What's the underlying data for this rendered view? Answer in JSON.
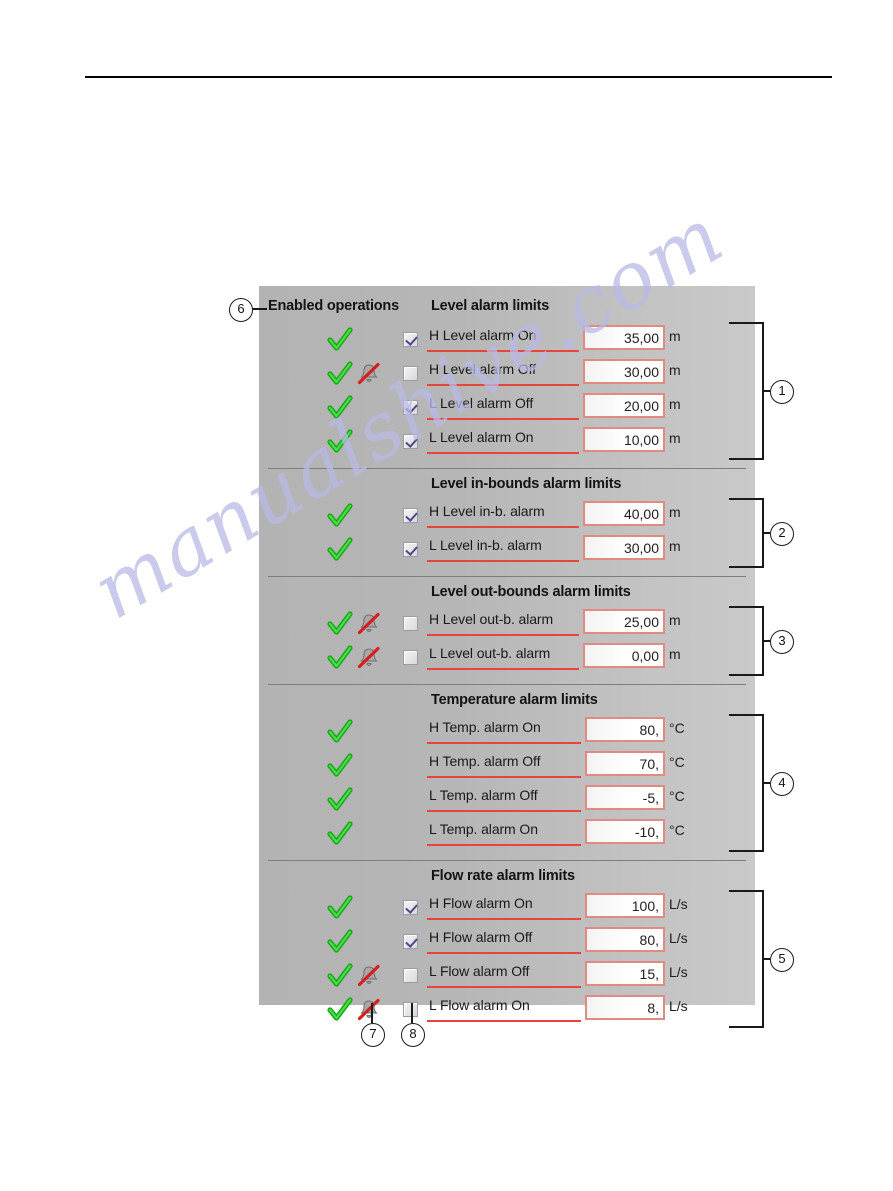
{
  "page": {
    "watermark_text": "manualshive.com",
    "accent_red": "#e8443c",
    "field_border": "#e08a84",
    "panel_gray": "#bcbcbc",
    "check_green": "#22bb22",
    "bell_red": "#d41f1f"
  },
  "panel": {
    "enabled_operations_header": "Enabled operations",
    "sections": [
      {
        "title": "Level alarm limits",
        "callout": "1",
        "rows": [
          {
            "ok": true,
            "bell": false,
            "checkbox": true,
            "label": "H Level alarm On",
            "value": "35,00",
            "unit": "m"
          },
          {
            "ok": true,
            "bell": true,
            "checkbox": false,
            "label": "H Level alarm Off",
            "value": "30,00",
            "unit": "m"
          },
          {
            "ok": true,
            "bell": false,
            "checkbox": true,
            "label": "L Level alarm Off",
            "value": "20,00",
            "unit": "m"
          },
          {
            "ok": true,
            "bell": false,
            "checkbox": true,
            "label": "L Level alarm On",
            "value": "10,00",
            "unit": "m"
          }
        ]
      },
      {
        "title": "Level in-bounds alarm limits",
        "callout": "2",
        "rows": [
          {
            "ok": true,
            "bell": false,
            "checkbox": true,
            "label": "H Level in-b. alarm",
            "value": "40,00",
            "unit": "m"
          },
          {
            "ok": true,
            "bell": false,
            "checkbox": true,
            "label": "L Level in-b. alarm",
            "value": "30,00",
            "unit": "m"
          }
        ]
      },
      {
        "title": "Level out-bounds alarm limits",
        "callout": "3",
        "rows": [
          {
            "ok": true,
            "bell": true,
            "checkbox": false,
            "label": "H Level out-b. alarm",
            "value": "25,00",
            "unit": "m"
          },
          {
            "ok": true,
            "bell": true,
            "checkbox": false,
            "label": "L Level out-b. alarm",
            "value": "0,00",
            "unit": "m"
          }
        ]
      },
      {
        "title": "Temperature alarm limits",
        "callout": "4",
        "rows": [
          {
            "ok": true,
            "bell": false,
            "checkbox": null,
            "label": "H Temp. alarm On",
            "value": "80,",
            "unit": "°C"
          },
          {
            "ok": true,
            "bell": false,
            "checkbox": null,
            "label": "H Temp. alarm Off",
            "value": "70,",
            "unit": "°C"
          },
          {
            "ok": true,
            "bell": false,
            "checkbox": null,
            "label": "L Temp. alarm Off",
            "value": "-5,",
            "unit": "°C"
          },
          {
            "ok": true,
            "bell": false,
            "checkbox": null,
            "label": "L Temp. alarm On",
            "value": "-10,",
            "unit": "°C"
          }
        ]
      },
      {
        "title": "Flow rate alarm limits",
        "callout": "5",
        "rows": [
          {
            "ok": true,
            "bell": false,
            "checkbox": true,
            "label": "H Flow alarm On",
            "value": "100,",
            "unit": "L/s"
          },
          {
            "ok": true,
            "bell": false,
            "checkbox": true,
            "label": "H Flow alarm Off",
            "value": "80,",
            "unit": "L/s"
          },
          {
            "ok": true,
            "bell": true,
            "checkbox": false,
            "label": "L Flow alarm Off",
            "value": "15,",
            "unit": "L/s"
          },
          {
            "ok": true,
            "bell": true,
            "checkbox": false,
            "label": "L Flow alarm On",
            "value": "8,",
            "unit": "L/s"
          }
        ]
      }
    ]
  },
  "callouts": {
    "enabled_operations": "6",
    "bell_column": "7",
    "checkbox_column": "8"
  }
}
